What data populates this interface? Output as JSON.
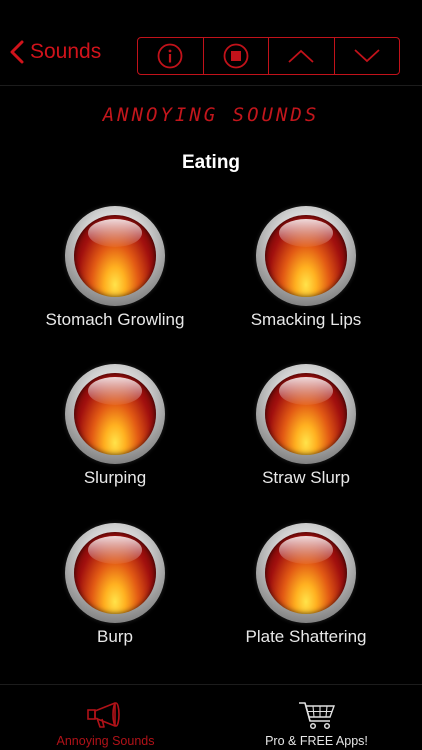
{
  "nav": {
    "back_label": "Sounds",
    "segments": [
      {
        "icon": "info-icon"
      },
      {
        "icon": "stop-icon"
      },
      {
        "icon": "chevron-up-icon"
      },
      {
        "icon": "chevron-down-icon"
      }
    ]
  },
  "header": {
    "brand": "ANNOYING SOUNDS",
    "category": "Eating"
  },
  "sounds": [
    {
      "label": "Stomach Growling"
    },
    {
      "label": "Smacking Lips"
    },
    {
      "label": "Slurping"
    },
    {
      "label": "Straw Slurp"
    },
    {
      "label": "Burp"
    },
    {
      "label": "Plate Shattering"
    }
  ],
  "tabs": [
    {
      "label": "Annoying Sounds",
      "icon": "megaphone-icon",
      "active": true
    },
    {
      "label": "Pro & FREE Apps!",
      "icon": "cart-icon",
      "active": false
    }
  ],
  "colors": {
    "accent": "#c1121a",
    "background": "#000000"
  }
}
